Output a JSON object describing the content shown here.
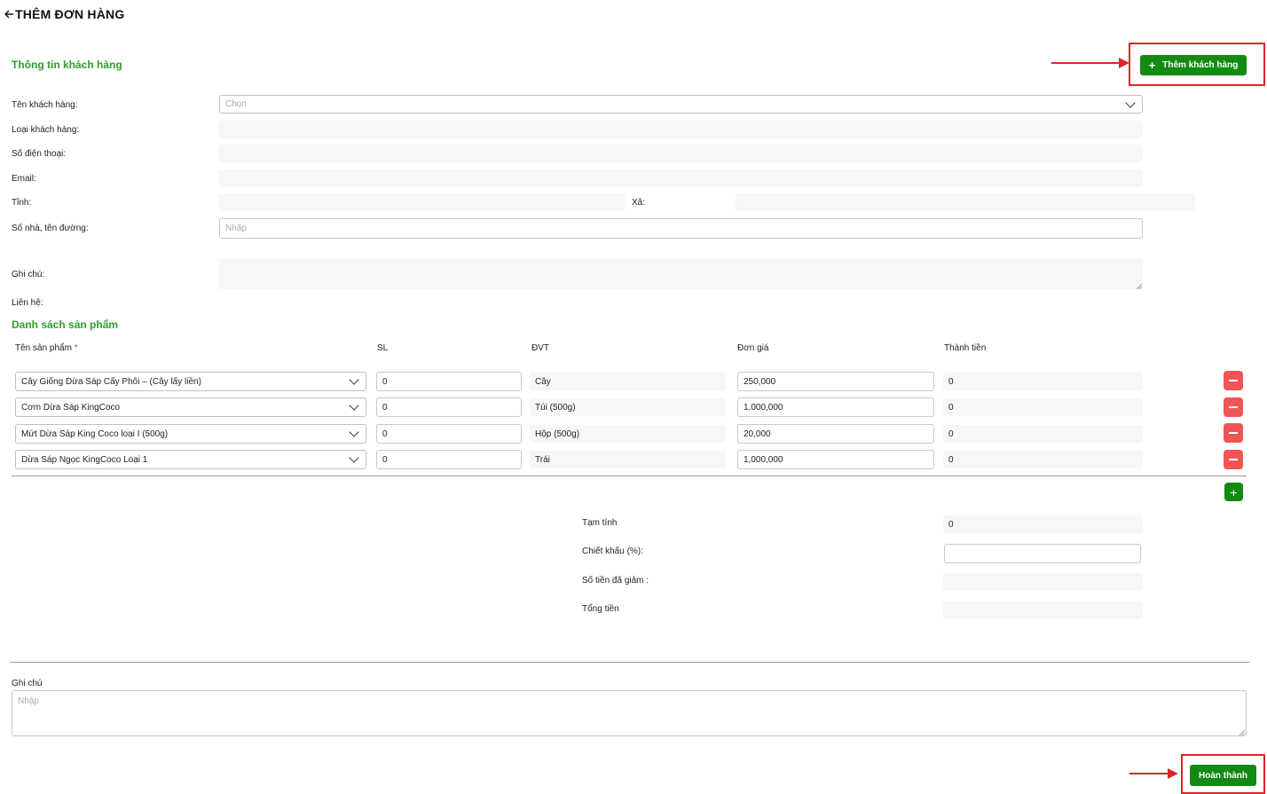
{
  "header": {
    "back_icon": "arrow-left-icon",
    "title": "THÊM ĐƠN HÀNG"
  },
  "customer_section": {
    "title": "Thông tin khách hàng",
    "add_button_label": "Thêm khách hàng",
    "fields": {
      "name_label": "Tên khách hàng:",
      "name_placeholder": "Chọn",
      "type_label": "Loại khách hàng:",
      "phone_label": "Số điện thoại:",
      "email_label": "Email:",
      "province_label": "Tỉnh:",
      "ward_label": "Xã:",
      "address_label": "Số nhà, tên đường:",
      "address_placeholder": "Nhập",
      "note_label": "Ghi chú:",
      "contact_label": "Liên hệ:"
    }
  },
  "products_section": {
    "title": "Danh sách sản phẩm",
    "columns": {
      "name": "Tên sản phẩm",
      "required_mark": "*",
      "qty": "SL",
      "unit": "ĐVT",
      "price": "Đơn giá",
      "total": "Thành tiền"
    },
    "rows": [
      {
        "name": "Cây Giống Dừa Sáp Cấy Phôi – (Cây lấy liền)",
        "qty": "0",
        "unit": "Cây",
        "price": "250,000",
        "total": "0"
      },
      {
        "name": "Cơm Dừa Sáp KingCoco",
        "qty": "0",
        "unit": "Túi (500g)",
        "price": "1,000,000",
        "total": "0"
      },
      {
        "name": "Mứt Dừa Sáp King Coco loại I (500g)",
        "qty": "0",
        "unit": "Hộp (500g)",
        "price": "20,000",
        "total": "0"
      },
      {
        "name": "Dừa Sáp Ngọc KingCoco Loại 1",
        "qty": "0",
        "unit": "Trái",
        "price": "1,000,000",
        "total": "0"
      }
    ]
  },
  "summary": {
    "subtotal_label": "Tạm tính",
    "subtotal_value": "0",
    "discount_label": "Chiết khấu (%):",
    "discount_value": "",
    "reduced_label": "Số tiền đã giảm :",
    "total_label": "Tổng tiền"
  },
  "footer": {
    "note_label": "Ghi chú",
    "note_placeholder": "Nhập",
    "complete_button_label": "Hoàn thành"
  },
  "colors": {
    "accent": "#138a12",
    "section_title": "#2e9c2e",
    "danger": "#f05555",
    "highlight": "#d9262a"
  }
}
